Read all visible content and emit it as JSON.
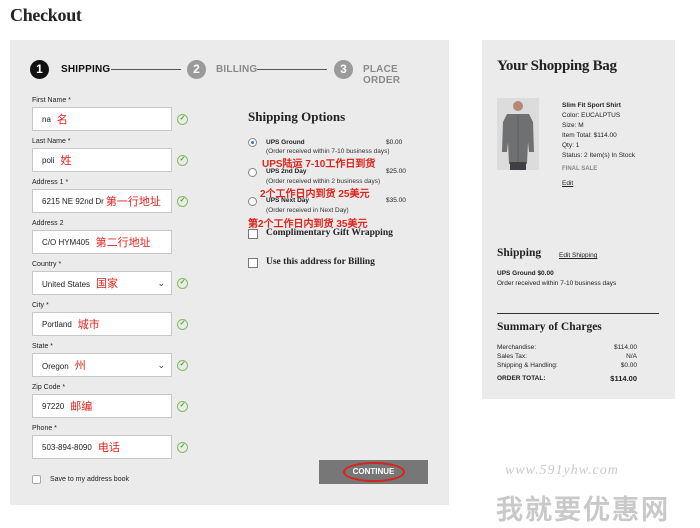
{
  "page_title": "Checkout",
  "steps": [
    {
      "num": "1",
      "label": "SHIPPING"
    },
    {
      "num": "2",
      "label": "BILLING"
    },
    {
      "num": "3",
      "label": "PLACE ORDER"
    }
  ],
  "fields": [
    {
      "label": "First Name *",
      "value": "na",
      "note": "名"
    },
    {
      "label": "Last Name *",
      "value": "poli",
      "note": "姓"
    },
    {
      "label": "Address 1 *",
      "value": "6215 NE 92nd Dr",
      "note": "第一行地址"
    },
    {
      "label": "Address 2",
      "value": "C/O HYM405",
      "note": "第二行地址"
    },
    {
      "label": "Country *",
      "value": "United States",
      "note": "国家"
    },
    {
      "label": "City *",
      "value": "Portland",
      "note": "城市"
    },
    {
      "label": "State *",
      "value": "Oregon",
      "note": "州"
    },
    {
      "label": "Zip Code *",
      "value": "97220",
      "note": "邮编"
    },
    {
      "label": "Phone *",
      "value": "503-894-8090",
      "note": "电话"
    }
  ],
  "save_address": "Save to my address book",
  "shipping_options": {
    "title": "Shipping Options",
    "options": [
      {
        "name": "UPS Ground",
        "price": "$0.00",
        "sub": "(Order received within 7-10 business days)",
        "note": "UPS陆运 7-10工作日到货"
      },
      {
        "name": "UPS 2nd Day",
        "price": "$25.00",
        "sub": "(Order received within 2 business days)",
        "note": "2个工作日内到货 25美元"
      },
      {
        "name": "UPS Next Day",
        "price": "$35.00",
        "sub": "(Order received in Next Day)",
        "note": "第2个工作日内到货 35美元"
      }
    ],
    "gift_wrap": "Complimentary Gift Wrapping",
    "billing_same": "Use this address for Billing"
  },
  "continue_label": "CONTINUE",
  "bag": {
    "title": "Your Shopping Bag",
    "item": {
      "name": "Slim Fit Sport Shirt",
      "color": "Color: EUCALPTUS",
      "size": "Size: M",
      "total": "Item Total: $114.00",
      "qty": "Qty: 1",
      "status": "Status: 2 Item(s) In Stock",
      "final": "FINAL SALE",
      "edit": "Edit"
    },
    "shipping_title": "Shipping",
    "edit_shipping": "Edit Shipping",
    "ship_method": "UPS Ground $0.00",
    "ship_note": "Order received within 7-10 business days",
    "summary_title": "Summary of Charges",
    "summary": [
      {
        "label": "Merchandise:",
        "value": "$114.00"
      },
      {
        "label": "Sales Tax:",
        "value": "N/A"
      },
      {
        "label": "Shipping & Handling:",
        "value": "$0.00"
      },
      {
        "label": "ORDER TOTAL:",
        "value": "$114.00"
      }
    ]
  },
  "watermark": {
    "url": "www.591yhw.com",
    "brand": "我就要优惠网"
  }
}
